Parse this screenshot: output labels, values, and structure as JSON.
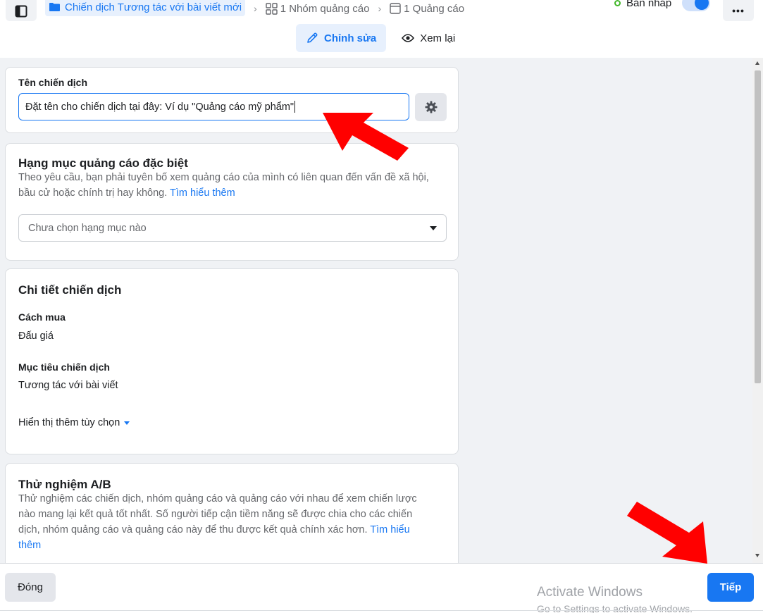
{
  "breadcrumb": {
    "campaign": "Chiến dịch Tương tác với bài viết mới",
    "adset": "1 Nhóm quảng cáo",
    "ad": "1 Quảng cáo"
  },
  "status": {
    "label": "Bản nháp"
  },
  "mode_tabs": {
    "edit": "Chỉnh sửa",
    "review": "Xem lại"
  },
  "campaign_name": {
    "label": "Tên chiến dịch",
    "value": "Đặt tên cho chiến dịch tại đây: Ví dụ \"Quảng cáo mỹ phẩm\""
  },
  "special_category": {
    "title": "Hạng mục quảng cáo đặc biệt",
    "desc_line1": "Theo yêu cầu, bạn phải tuyên bố xem quảng cáo của mình có liên quan đến vấn đề xã hội,",
    "desc_line2": "bầu cử hoặc chính trị hay không.",
    "learn_more": "Tìm hiểu thêm",
    "select_placeholder": "Chưa chọn hạng mục nào"
  },
  "details": {
    "title": "Chi tiết chiến dịch",
    "buying_label": "Cách mua",
    "buying_value": "Đấu giá",
    "objective_label": "Mục tiêu chiến dịch",
    "objective_value": "Tương tác với bài viết",
    "more_options": "Hiển thị thêm tùy chọn"
  },
  "ab_test": {
    "title": "Thử nghiệm A/B",
    "line1": "Thử nghiệm các chiến dịch, nhóm quảng cáo và quảng cáo với nhau để xem chiến lược",
    "line2": "nào mang lại kết quả tốt nhất. Số người tiếp cận tiềm năng sẽ được chia cho các chiến",
    "line3": "dịch, nhóm quảng cáo và quảng cáo này để thu được kết quả chính xác hơn.",
    "learn_more_1": "Tìm hiểu",
    "learn_more_2": "thêm"
  },
  "footer": {
    "close": "Đóng",
    "next": "Tiếp",
    "windows_title": "Activate Windows",
    "windows_sub": "Go to Settings to activate Windows."
  },
  "colors": {
    "accent": "#1877f2",
    "arrow": "#ff0000"
  }
}
